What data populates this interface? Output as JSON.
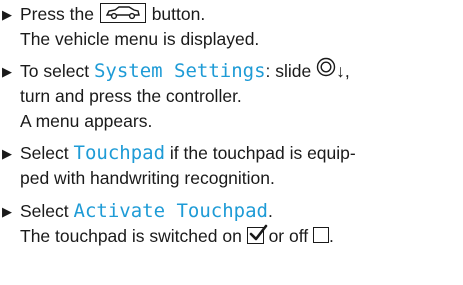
{
  "steps": [
    {
      "lines": [
        {
          "pre": "Press the",
          "post": "button."
        },
        {
          "text": "The vehicle menu is displayed."
        }
      ]
    },
    {
      "lines": [
        {
          "pre": "To select",
          "ui": "System Settings",
          "mid": ": slide",
          "post": ",",
          "arrow": "↓"
        },
        {
          "text": "turn and press the controller."
        },
        {
          "text": "A menu appears."
        }
      ]
    },
    {
      "lines": [
        {
          "pre": "Select",
          "ui": "Touchpad",
          "post": "if the touchpad is equip-"
        },
        {
          "text": "ped with handwriting recognition."
        }
      ]
    },
    {
      "lines": [
        {
          "pre": "Select",
          "ui": "Activate Touchpad",
          "post": "."
        },
        {
          "pre": "The touchpad is switched on",
          "mid": "or off",
          "post": "."
        }
      ]
    }
  ],
  "bullet_glyph": "▶",
  "colors": {
    "ui_text": "#1e9bd6",
    "body_text": "#1a1a1a"
  },
  "icons": [
    "vehicle-button-icon",
    "controller-icon",
    "checked-box-icon",
    "unchecked-box-icon"
  ]
}
